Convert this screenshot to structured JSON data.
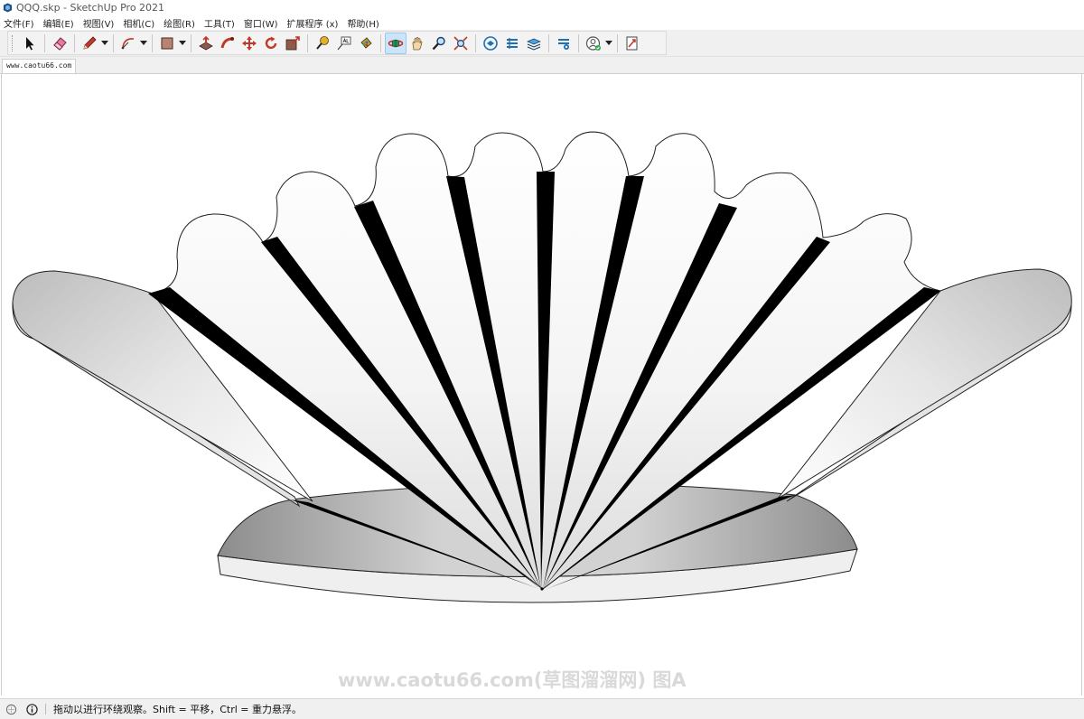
{
  "window": {
    "title": "QQQ.skp - SketchUp Pro 2021"
  },
  "menu": [
    {
      "label": "文件(F)"
    },
    {
      "label": "编辑(E)"
    },
    {
      "label": "视图(V)"
    },
    {
      "label": "相机(C)"
    },
    {
      "label": "绘图(R)"
    },
    {
      "label": "工具(T)"
    },
    {
      "label": "窗口(W)"
    },
    {
      "label": "扩展程序 (x)"
    },
    {
      "label": "帮助(H)"
    }
  ],
  "toolbar": {
    "tools": [
      {
        "icon": "select-arrow-icon"
      },
      {
        "icon": "eraser-icon"
      },
      {
        "icon": "pencil-line-icon",
        "dropdown": true
      },
      {
        "icon": "arc-icon",
        "dropdown": true
      },
      {
        "icon": "rectangle-icon",
        "dropdown": true
      },
      {
        "icon": "push-pull-icon"
      },
      {
        "icon": "follow-me-icon"
      },
      {
        "icon": "move-icon"
      },
      {
        "icon": "rotate-icon"
      },
      {
        "icon": "scale-icon"
      },
      {
        "icon": "tape-measure-icon"
      },
      {
        "icon": "text-icon"
      },
      {
        "icon": "paint-bucket-icon"
      },
      {
        "icon": "orbit-icon",
        "active": true
      },
      {
        "icon": "pan-icon"
      },
      {
        "icon": "zoom-icon"
      },
      {
        "icon": "zoom-extents-icon"
      },
      {
        "icon": "warehouse-icon"
      },
      {
        "icon": "extension-warehouse-icon"
      },
      {
        "icon": "layout-icon"
      },
      {
        "icon": "extension-manager-icon"
      },
      {
        "icon": "user-account-icon",
        "dropdown": true
      },
      {
        "icon": "send-to-layout-icon"
      }
    ]
  },
  "scene_tab": {
    "label": "www.caotu66.com"
  },
  "watermark": "www.caotu66.com(草图溜溜网) 图A",
  "status": {
    "message": "拖动以进行环绕观察。Shift = 平移，Ctrl = 重力悬浮。"
  },
  "colors": {
    "chrome": "#f0f0f0",
    "viewport_bg": "#ffffff",
    "active_tool": "#cce4f7",
    "model_stripe": "#000000"
  }
}
